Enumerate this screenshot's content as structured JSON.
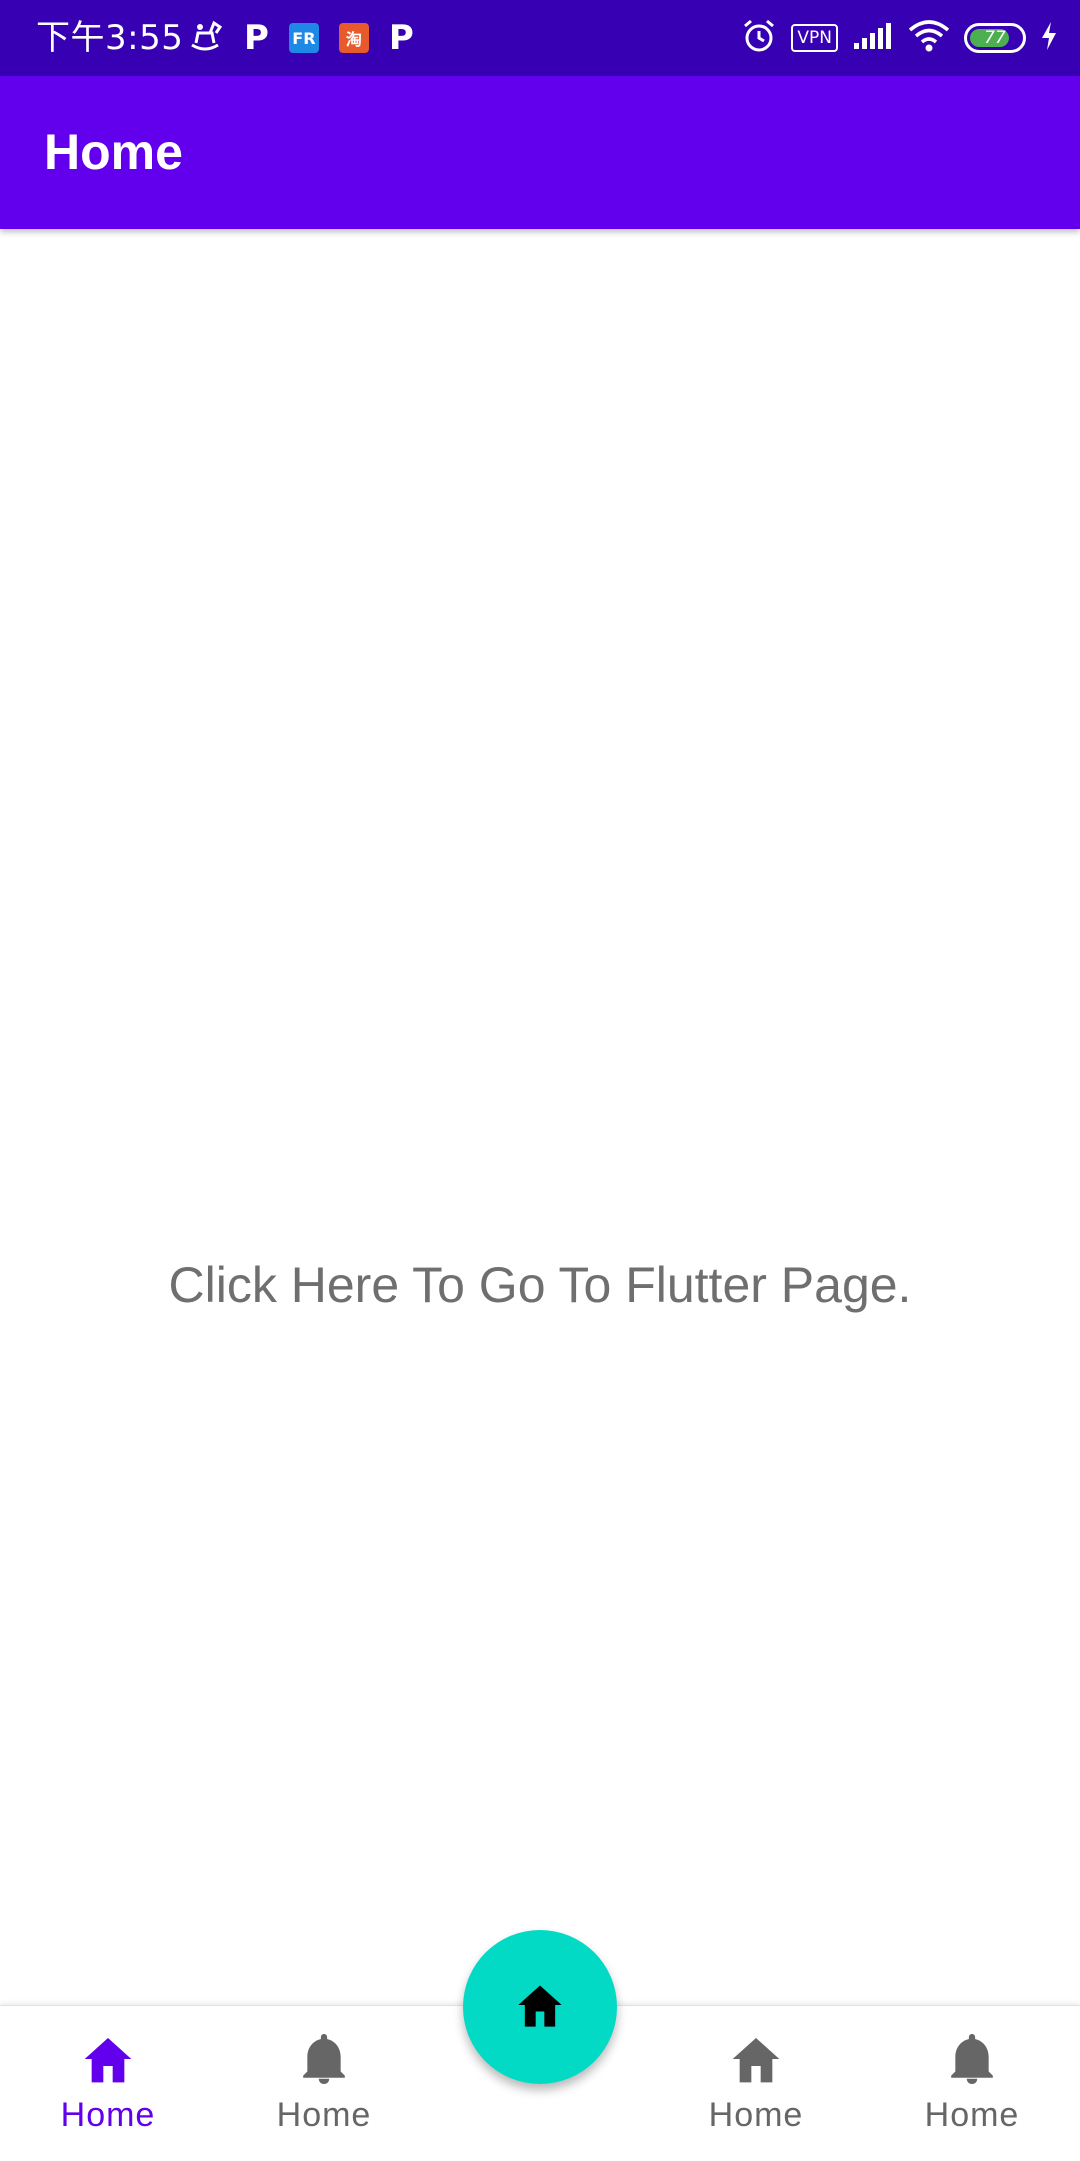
{
  "status_bar": {
    "time": "下午3:55",
    "left_icons": [
      "rocking-horse-icon",
      "p-app-icon",
      "fr-app-icon",
      "taobao-app-icon",
      "p-app-icon"
    ],
    "app_icon_labels": {
      "fr": "FR",
      "taobao": "淘"
    },
    "p_letter": "P",
    "vpn_label": "VPN",
    "battery_level": "77",
    "battery_fraction": 0.77,
    "colors": {
      "background": "#3700b3",
      "battery_fill": "#4caf50"
    }
  },
  "app_bar": {
    "title": "Home",
    "color": "#6200ee"
  },
  "content": {
    "link_text": "Click Here To Go To Flutter Page."
  },
  "bottom_nav": {
    "items": [
      {
        "label": "Home",
        "icon": "home-icon",
        "active": true
      },
      {
        "label": "Home",
        "icon": "bell-icon",
        "active": false
      },
      {
        "label": "Home",
        "icon": "home-icon",
        "active": false
      },
      {
        "label": "Home",
        "icon": "bell-icon",
        "active": false
      }
    ],
    "active_color": "#6200ee",
    "inactive_color": "#666666"
  },
  "fab": {
    "icon": "home-icon",
    "color": "#03dac5"
  }
}
